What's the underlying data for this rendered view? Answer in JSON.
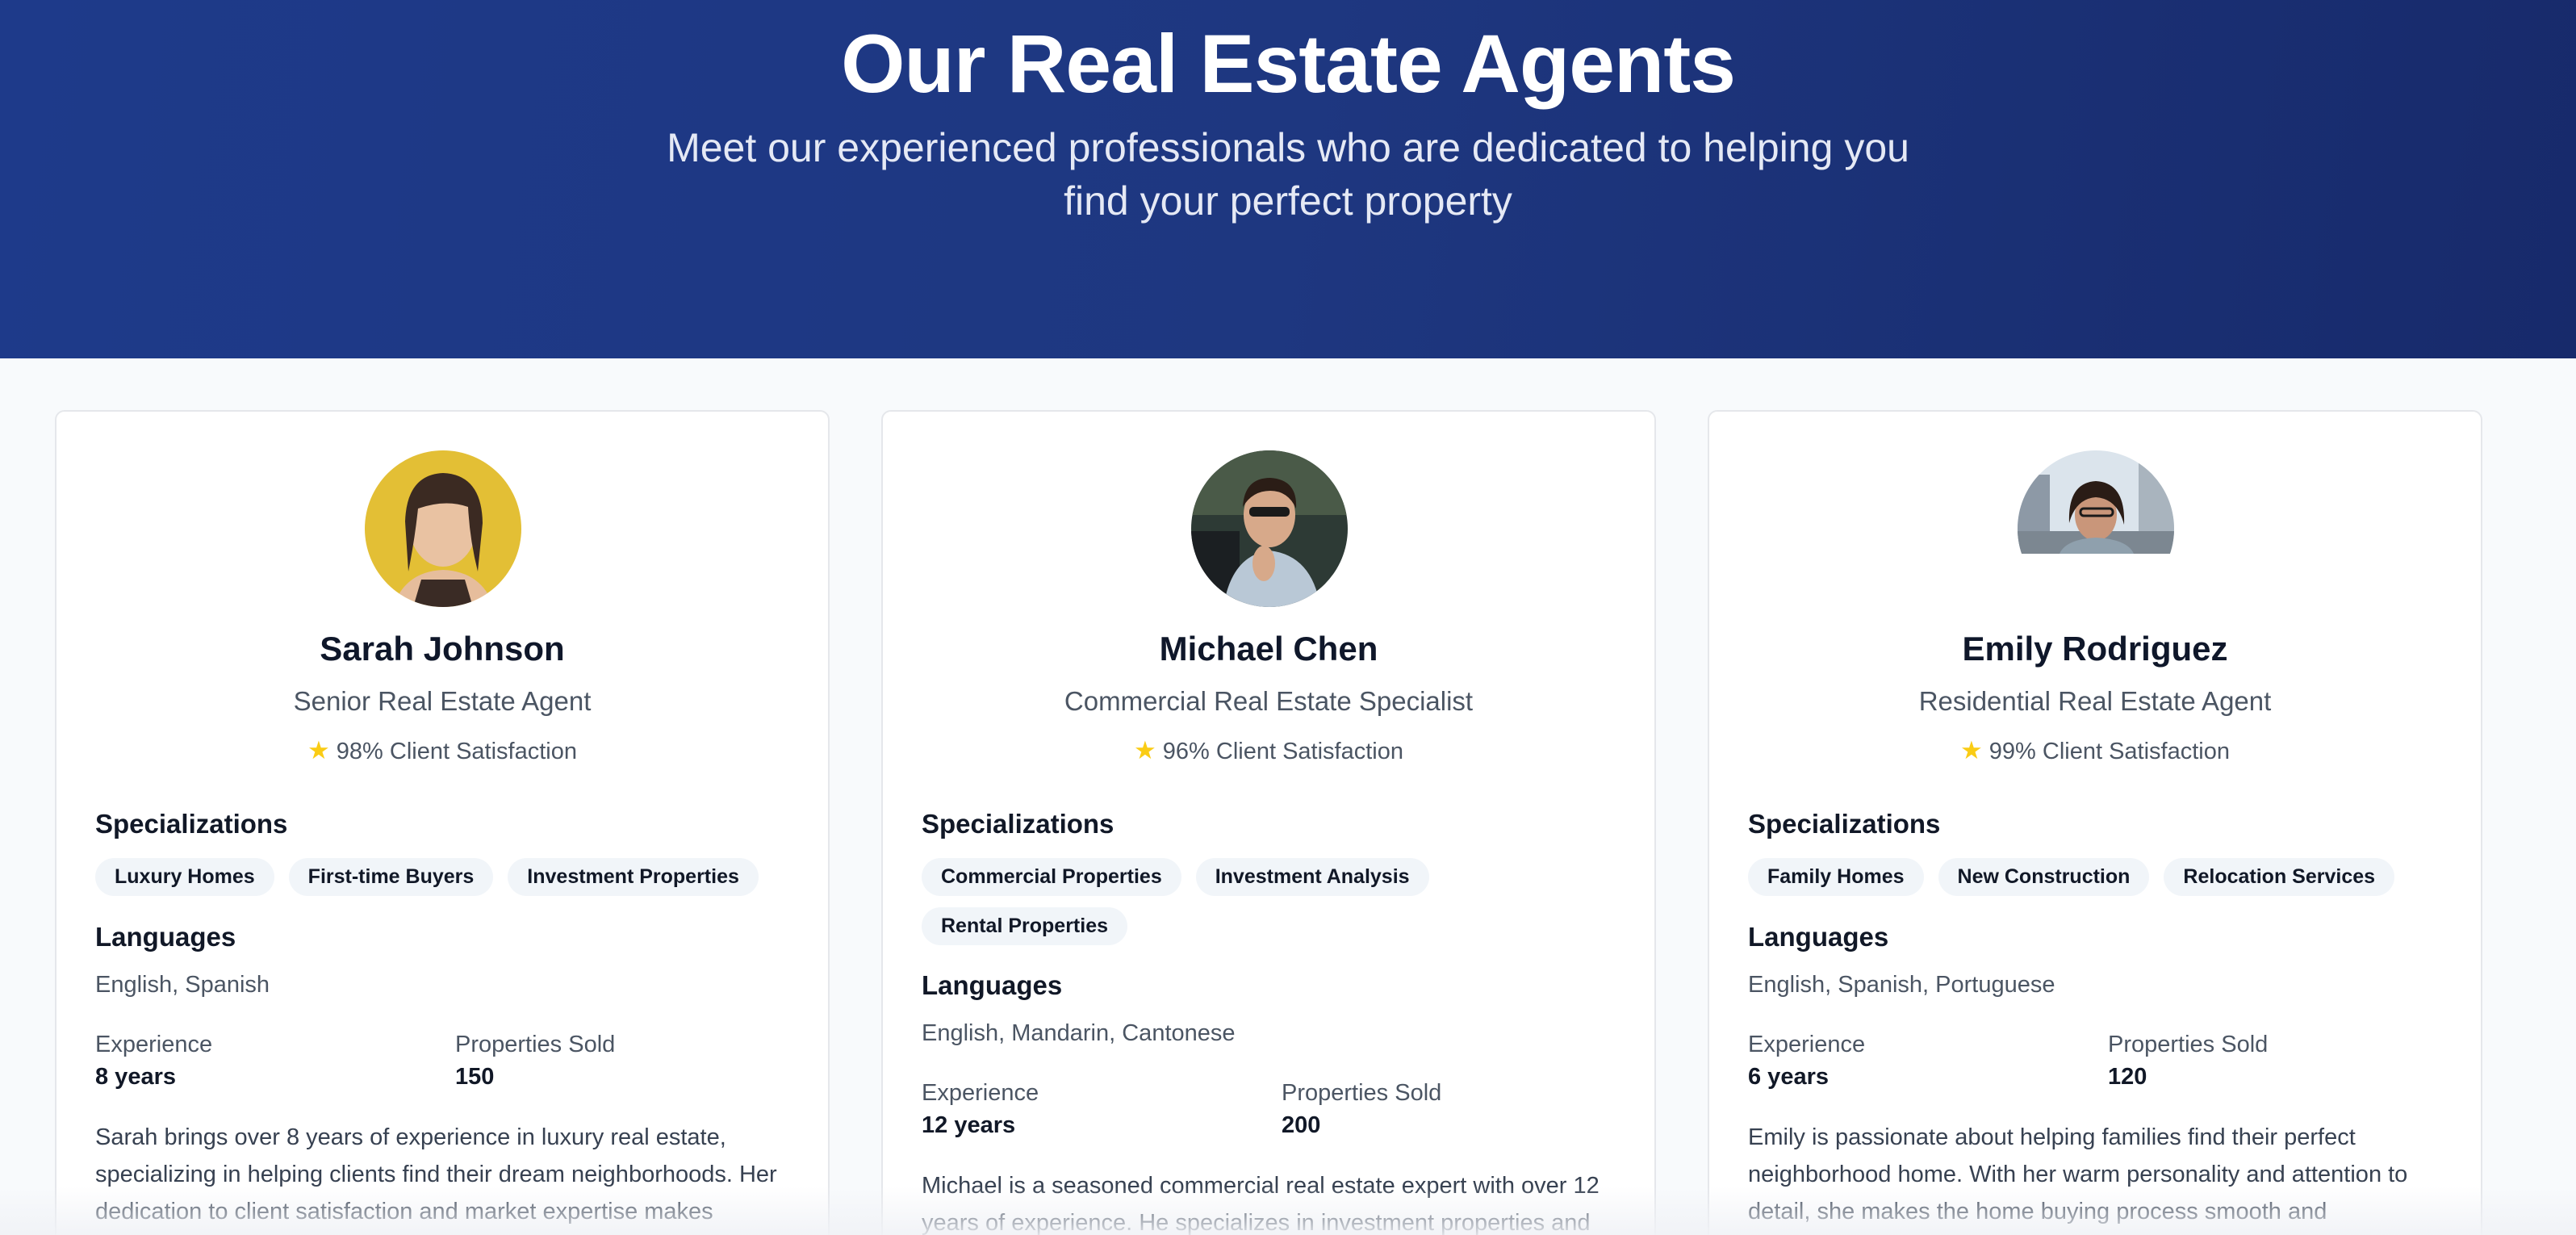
{
  "hero": {
    "title": "Our Real Estate Agents",
    "subtitle": "Meet our experienced professionals who are dedicated to helping you find your perfect property"
  },
  "labels": {
    "specializations": "Specializations",
    "languages": "Languages",
    "experience": "Experience",
    "properties_sold": "Properties Sold"
  },
  "agents": [
    {
      "name": "Sarah Johnson",
      "role": "Senior Real Estate Agent",
      "satisfaction": "98% Client Satisfaction",
      "specializations": [
        "Luxury Homes",
        "First-time Buyers",
        "Investment Properties"
      ],
      "languages": "English, Spanish",
      "experience": "8 years",
      "properties_sold": "150",
      "bio": "Sarah brings over 8 years of experience in luxury real estate, specializing in helping clients find their dream neighborhoods. Her dedication to client satisfaction and market expertise makes"
    },
    {
      "name": "Michael Chen",
      "role": "Commercial Real Estate Specialist",
      "satisfaction": "96% Client Satisfaction",
      "specializations": [
        "Commercial Properties",
        "Investment Analysis",
        "Rental Properties"
      ],
      "languages": "English, Mandarin, Cantonese",
      "experience": "12 years",
      "properties_sold": "200",
      "bio": "Michael is a seasoned commercial real estate expert with over 12 years of experience. He specializes in investment properties and"
    },
    {
      "name": "Emily Rodriguez",
      "role": "Residential Real Estate Agent",
      "satisfaction": "99% Client Satisfaction",
      "specializations": [
        "Family Homes",
        "New Construction",
        "Relocation Services"
      ],
      "languages": "English, Spanish, Portuguese",
      "experience": "6 years",
      "properties_sold": "120",
      "bio": "Emily is passionate about helping families find their perfect neighborhood home. With her warm personality and attention to detail, she makes the home buying process smooth and"
    }
  ],
  "colors": {
    "hero_bg": "#1e3a8a",
    "star": "#facc15",
    "tag_bg": "#f1f5f9"
  }
}
